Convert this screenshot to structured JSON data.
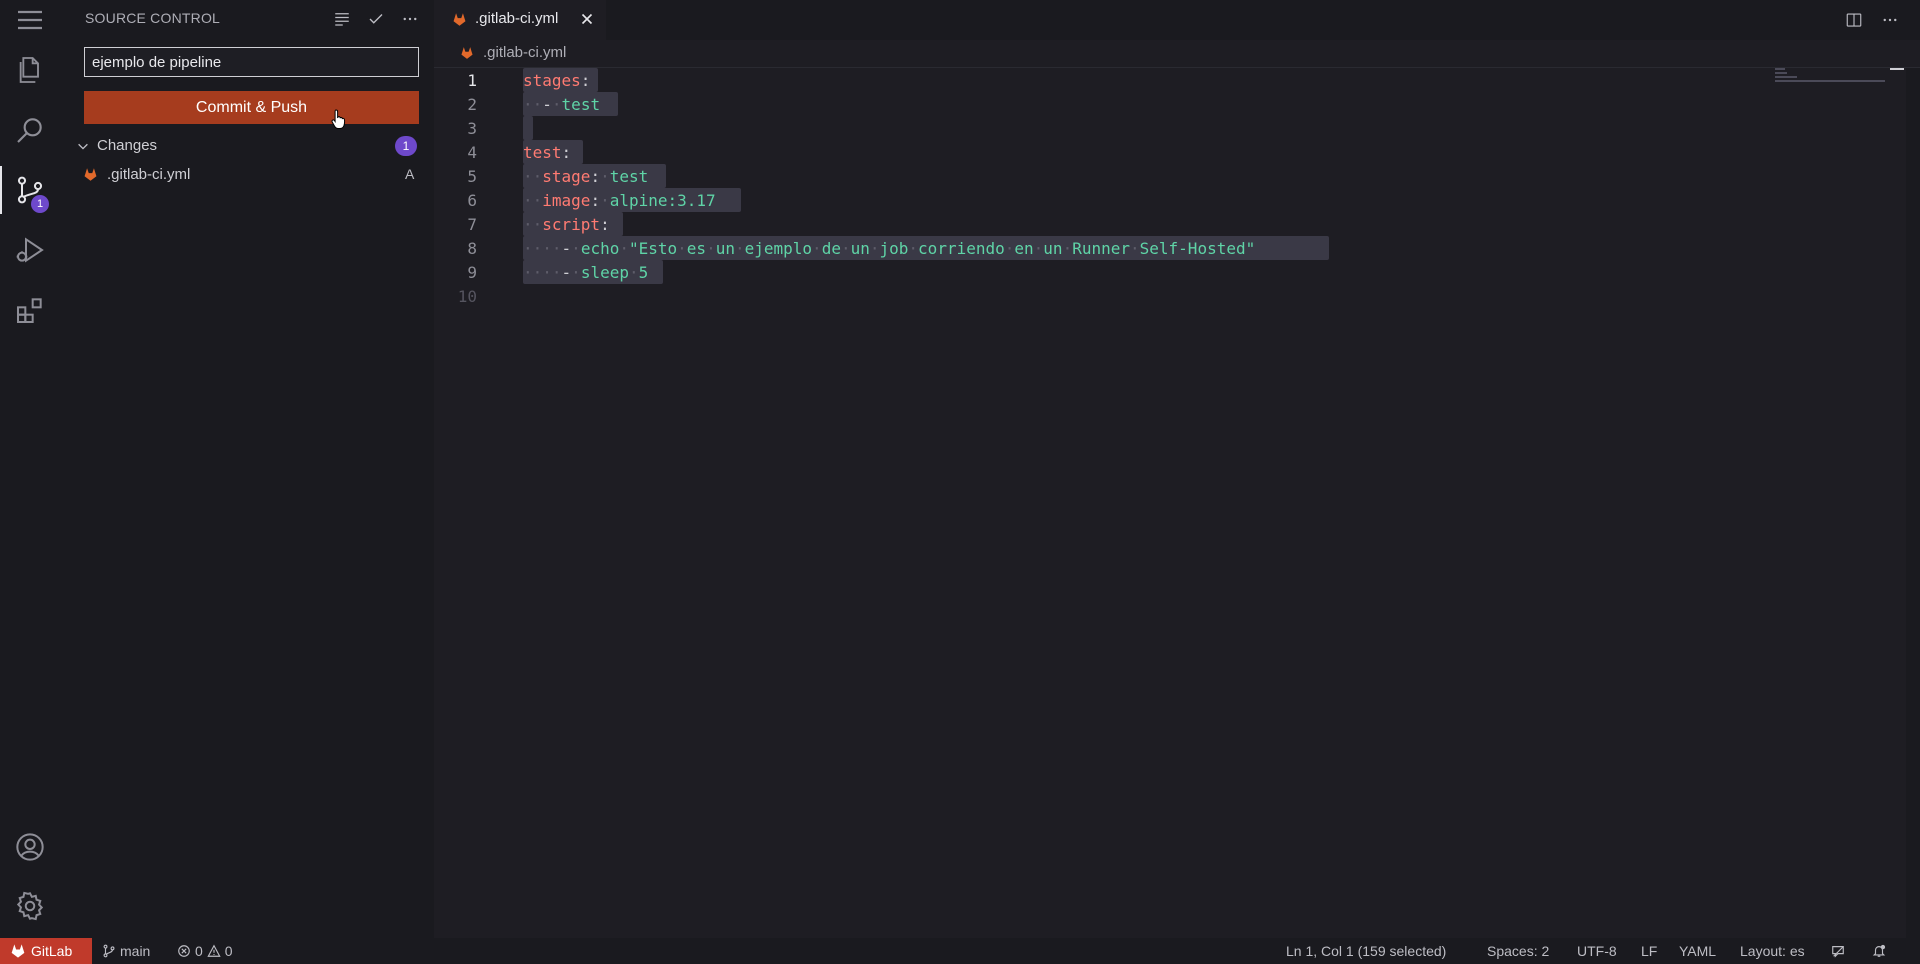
{
  "sidebar": {
    "title": "SOURCE CONTROL",
    "commit_message": "ejemplo de pipeline",
    "commit_button": "Commit & Push",
    "changes_label": "Changes",
    "changes_count": "1",
    "files": [
      {
        "name": ".gitlab-ci.yml",
        "status": "A"
      }
    ]
  },
  "activity": {
    "scm_badge": "1"
  },
  "editor": {
    "tab_title": ".gitlab-ci.yml",
    "breadcrumb": ".gitlab-ci.yml",
    "line_numbers": [
      "1",
      "2",
      "3",
      "4",
      "5",
      "6",
      "7",
      "8",
      "9",
      "10"
    ]
  },
  "statusbar": {
    "remote": "GitLab",
    "branch": "main",
    "errors": "0",
    "warnings": "0",
    "position": "Ln 1, Col 1 (159 selected)",
    "spaces": "Spaces: 2",
    "encoding": "UTF-8",
    "eol": "LF",
    "language": "YAML",
    "layout": "Layout: es"
  },
  "colors": {
    "accent_commit": "#a63c1e",
    "badge": "#6e49cb",
    "status_remote": "#c03a2b",
    "yaml_key": "#ff7b72",
    "yaml_string": "#5fd4a7"
  },
  "icons": [
    "menu-icon",
    "files-icon",
    "search-icon",
    "source-control-icon",
    "run-debug-icon",
    "extensions-icon",
    "account-icon",
    "settings-gear-icon"
  ]
}
